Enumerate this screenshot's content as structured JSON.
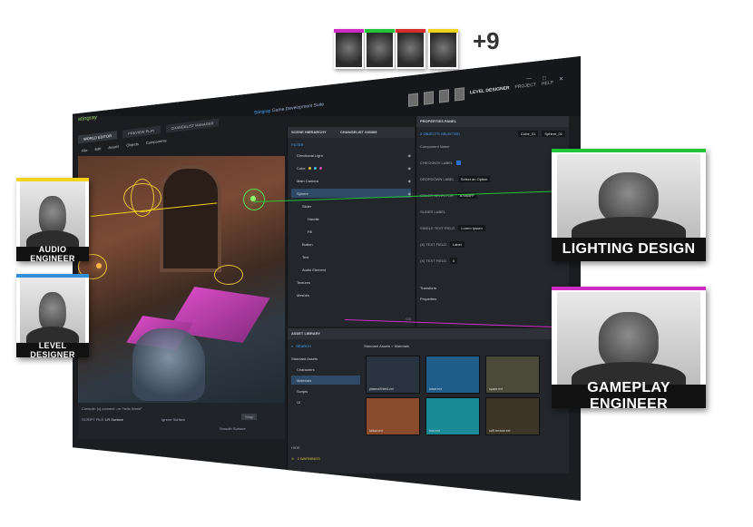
{
  "window": {
    "title_brand": "Stingray",
    "title_rest": "Game Development Suite",
    "controls": [
      "—",
      "□",
      "✕"
    ],
    "user": {
      "role": "LEVEL DESIGNER",
      "menu_project": "PROJECT",
      "menu_help": "HELP"
    }
  },
  "app": {
    "logo": "stingray",
    "tabs": [
      "WORLD EDITOR",
      "PREVIEW PLAY",
      "CHANGELIST MANAGER"
    ],
    "menu": [
      "File",
      "Edit",
      "Assets",
      "Objects",
      "Components"
    ],
    "viewport_tab": "SCENE VIEW",
    "status": {
      "line1": "Console: [x] connect –m \"hello World\"",
      "script_label": "SCRIPT FILE:",
      "script_value": "LR Surface",
      "ignore": "Ignore Surface",
      "snap": "Snap",
      "smooth": "Smooth Surface"
    }
  },
  "hierarchy": {
    "tabs": [
      "SCENE HIERARCHY",
      "CHANGELIST 045389"
    ],
    "filter": "FILTER",
    "items": [
      {
        "label": "Directional Light",
        "selected": false,
        "indent": 1
      },
      {
        "label": "Cube",
        "selected": false,
        "indent": 1,
        "dots": [
          "#e0c341",
          "#43c0e0",
          "#d44ac2"
        ]
      },
      {
        "label": "Main Camera",
        "selected": false,
        "indent": 1
      },
      {
        "label": "Sphere",
        "selected": true,
        "indent": 1
      },
      {
        "label": "Slider",
        "selected": false,
        "indent": 2
      },
      {
        "label": "Handle",
        "selected": false,
        "indent": 3
      },
      {
        "label": "Fill",
        "selected": false,
        "indent": 3
      },
      {
        "label": "Button",
        "selected": false,
        "indent": 2
      },
      {
        "label": "Text",
        "selected": false,
        "indent": 2
      },
      {
        "label": "Audio Element",
        "selected": false,
        "indent": 2
      },
      {
        "label": "Textures",
        "selected": false,
        "indent": 1
      },
      {
        "label": "Meshes",
        "selected": false,
        "indent": 1
      }
    ],
    "footer": "0/3"
  },
  "properties": {
    "title": "PROPERTIES PANEL",
    "selected_count": "2 OBJECTS SELECTED",
    "obj1": "Cube_01",
    "obj2": "Sphere_01",
    "rows": [
      {
        "label": "Component Name",
        "value": ""
      },
      {
        "label": "CHECKBOX LABEL",
        "value": ""
      },
      {
        "label": "DROPDOWN LABEL",
        "value": "Select an Option"
      },
      {
        "label": "COLOR SELECTOR",
        "value": "#7980FF"
      },
      {
        "label": "SLIDER LABEL",
        "value": ""
      },
      {
        "label": "SINGLE TEXT FIELD",
        "value": "Lorem Ipsum"
      },
      {
        "label": "(X) TEXT FIELD",
        "value": "Label"
      },
      {
        "label": "(X) TEXT FIELD",
        "value": "0"
      }
    ],
    "sections": [
      "Transform",
      "Properties"
    ]
  },
  "assets": {
    "tab": "ASSET LIBRARY",
    "search": "SEARCH",
    "tree": [
      "Standard Assets",
      "Characters",
      "Materials",
      "Scripts",
      "UI"
    ],
    "breadcrumb": "Standard Assets > Materials",
    "tiles": [
      {
        "name": "plasmaShield.ext",
        "color": "#2a3340"
      },
      {
        "name": "wave.ext",
        "color": "#1f5d8a"
      },
      {
        "name": "space.ext",
        "color": "#4b4a3a"
      },
      {
        "name": "fallout.ext",
        "color": "#8a4a2c"
      },
      {
        "name": "tron.ext",
        "color": "#1a8a96"
      },
      {
        "name": "scifi-texture.ext",
        "color": "#3d3528"
      }
    ],
    "footer_hide": "HIDE",
    "warnings": "2 WARNINGS"
  },
  "cards": {
    "audio": {
      "label": "AUDIO ENGINEER",
      "accent": "#f2d21a"
    },
    "level": {
      "label": "LEVEL DESIGNER",
      "accent": "#2f8fd9"
    },
    "lighting": {
      "label": "LIGHTING DESIGN",
      "accent": "#22c43a"
    },
    "gameplay": {
      "label": "GAMEPLAY ENGINEER",
      "accent": "#d12bc5"
    }
  },
  "collaborators": {
    "accents": [
      "#d12bc5",
      "#22c43a",
      "#d82b2b",
      "#f2d21a"
    ],
    "extra": "+9"
  }
}
